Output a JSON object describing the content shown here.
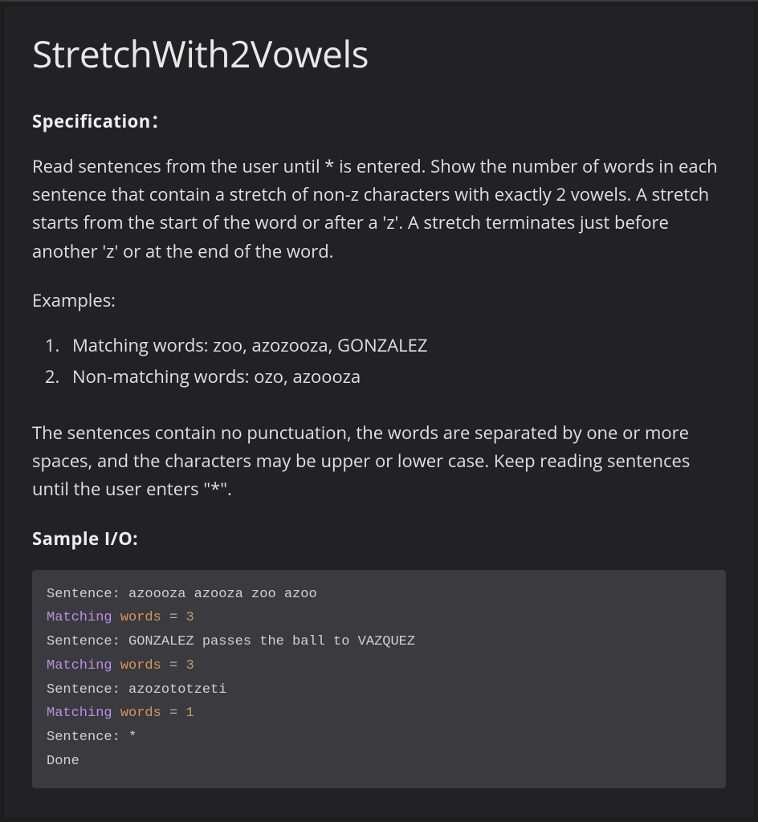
{
  "title": "StretchWith2Vowels",
  "spec_label": "Specification：",
  "spec_paragraph": "Read sentences from the user until * is entered. Show the number of words in each sentence that contain a stretch of non-z characters with exactly 2 vowels. A stretch starts from the start of the word or after a 'z'. A stretch terminates just before another 'z' or at the end of the word.",
  "examples_label": "Examples:",
  "example_items": [
    "Matching words: zoo, azozooza, GONZALEZ",
    "Non-matching words: ozo, azoooza"
  ],
  "spec_paragraph2": "The sentences contain no punctuation, the words are separated by one or more spaces, and the characters may be upper or lower case. Keep reading sentences until the user enters \"*\".",
  "sample_io_label": "Sample I/O:",
  "io": {
    "line1_prompt": "Sentence: azoooza azooza zoo azoo",
    "line2": {
      "kw": "Matching",
      "var": "words",
      "eq": "=",
      "num": "3"
    },
    "line3_prompt": "Sentence: GONZALEZ passes the ball to VAZQUEZ",
    "line4": {
      "kw": "Matching",
      "var": "words",
      "eq": "=",
      "num": "3"
    },
    "line5_prompt": "Sentence: azozototzeti",
    "line6": {
      "kw": "Matching",
      "var": "words",
      "eq": "=",
      "num": "1"
    },
    "line7_prompt": "Sentence: *",
    "line8_done": "Done"
  }
}
